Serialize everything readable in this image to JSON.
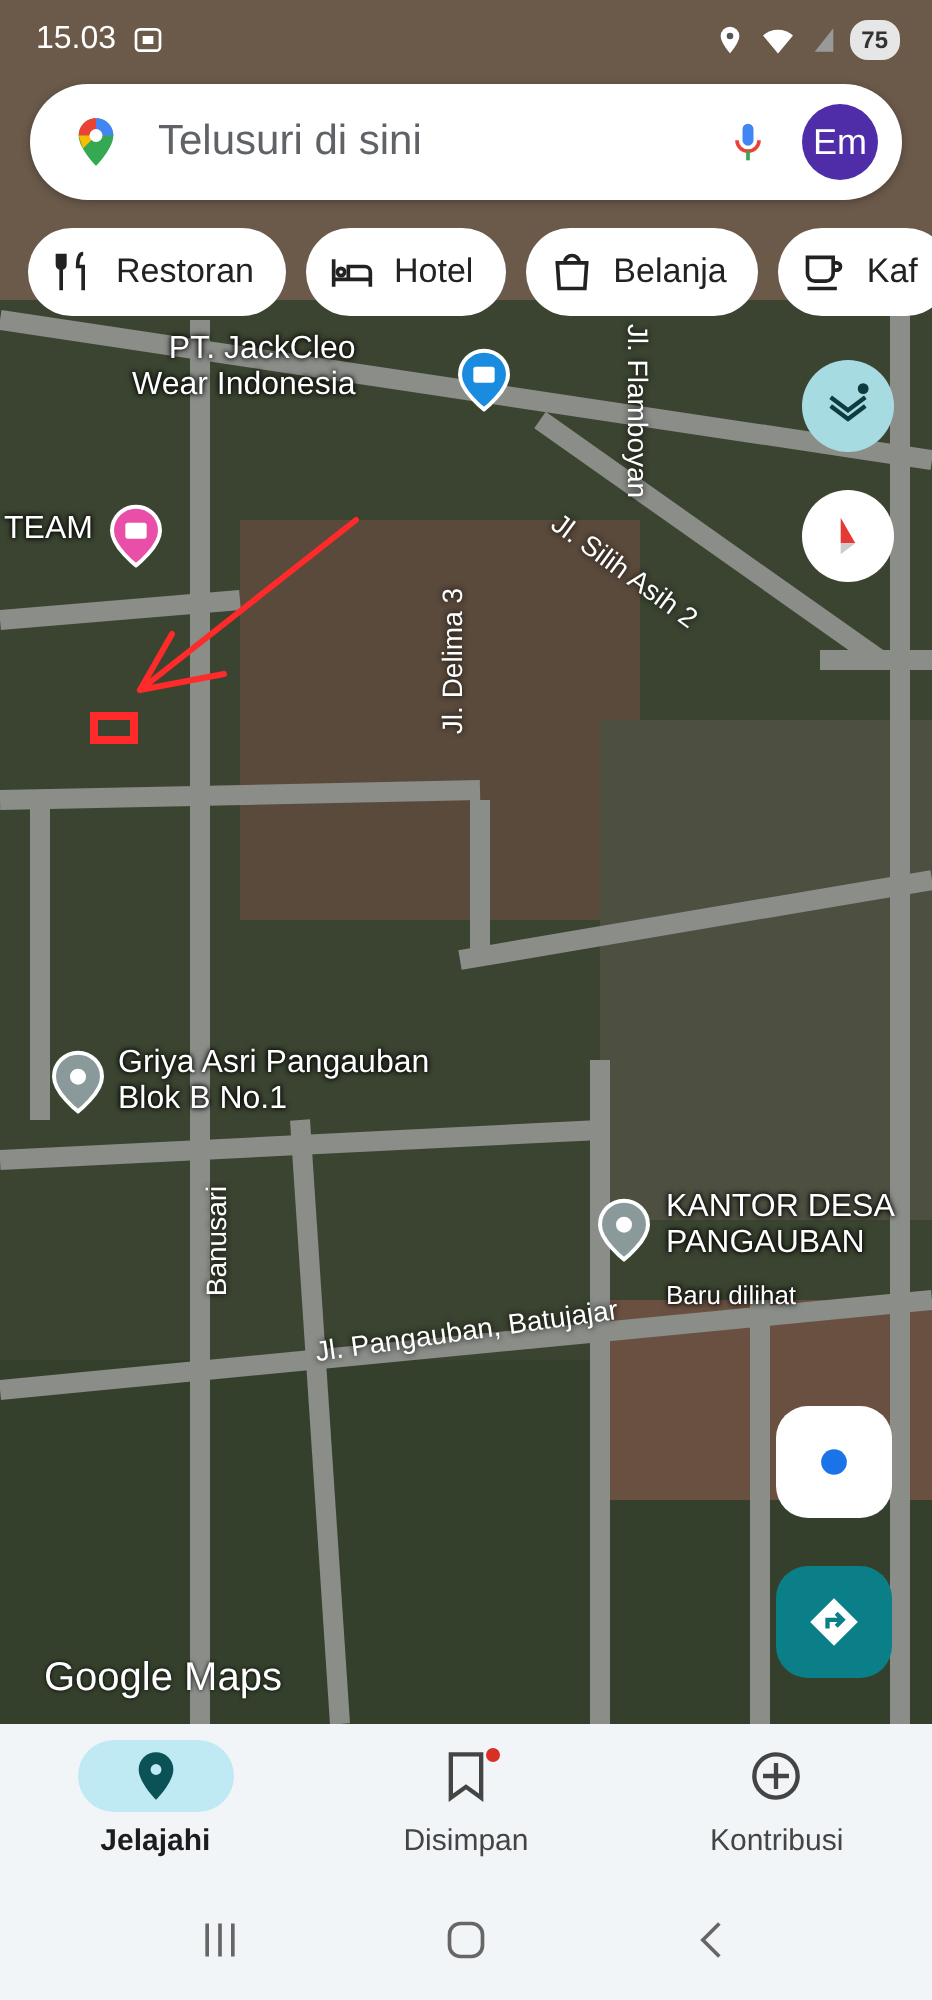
{
  "status_bar": {
    "time": "15.03",
    "battery": "75"
  },
  "search": {
    "placeholder": "Telusuri di sini",
    "avatar": "Em"
  },
  "chips": [
    {
      "label": "Restoran",
      "kind": "restaurant"
    },
    {
      "label": "Hotel",
      "kind": "hotel"
    },
    {
      "label": "Belanja",
      "kind": "shopping"
    },
    {
      "label": "Kaf",
      "kind": "cafe"
    }
  ],
  "map": {
    "places": [
      {
        "lines": [
          "PT. JackCleo",
          "Wear Indonesia"
        ],
        "kind": "shop"
      },
      {
        "lines": [
          "TEAM"
        ],
        "kind": "hotel"
      },
      {
        "lines": [
          "Griya Asri Pangauban",
          "Blok B No.1"
        ],
        "kind": "place"
      },
      {
        "lines": [
          "KANTOR DESA",
          "PANGAUBAN"
        ],
        "note": "Baru dilihat",
        "kind": "place"
      }
    ],
    "streets": [
      "Jl. Flamboyan",
      "Jl. Silih Asih 2",
      "Jl. Delima 3",
      "Banusari",
      "Jl. Pangauban, Batujajar"
    ],
    "attribution": "Google Maps"
  },
  "nav": [
    {
      "label": "Jelajahi",
      "kind": "explore",
      "selected": true,
      "notification": false
    },
    {
      "label": "Disimpan",
      "kind": "saved",
      "selected": false,
      "notification": true
    },
    {
      "label": "Kontribusi",
      "kind": "contribute",
      "selected": false,
      "notification": false
    }
  ]
}
